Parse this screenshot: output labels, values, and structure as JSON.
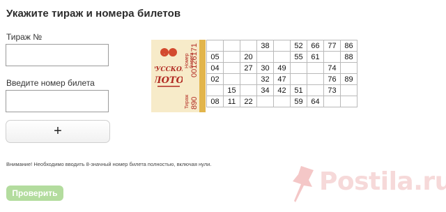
{
  "page": {
    "title": "Укажите тираж и номера билетов"
  },
  "form": {
    "draw_label": "Тираж №",
    "ticket_label": "Введите номер билета",
    "add_button": "+",
    "note": "Внимание! Необходимо вводить 8-значный номер билета полностью, включая нули.",
    "check_button": "Проверить"
  },
  "ticket": {
    "draw_caption": "Тираж",
    "draw_number": "890",
    "number_caption": "Номер билета",
    "ticket_number": "00126171",
    "logo_text": "РУССКОЕ ЛОТО",
    "rows": [
      [
        "",
        "",
        "",
        "38",
        "",
        "52",
        "66",
        "77",
        "86"
      ],
      [
        "05",
        "",
        "20",
        "",
        "",
        "55",
        "61",
        "",
        "88"
      ],
      [
        "04",
        "",
        "27",
        "30",
        "49",
        "",
        "",
        "74",
        ""
      ],
      [
        "02",
        "",
        "",
        "32",
        "47",
        "",
        "",
        "76",
        "89"
      ],
      [
        "",
        "15",
        "",
        "34",
        "42",
        "51",
        "",
        "73",
        ""
      ],
      [
        "08",
        "11",
        "22",
        "",
        "",
        "59",
        "64",
        "",
        ""
      ]
    ]
  },
  "watermark": {
    "text": "Postila.ru",
    "color": "#f4c7c7"
  },
  "colors": {
    "check_button": "#b3dc9e",
    "ticket_stub": "#f7ebc9",
    "ticket_red": "#b12a22"
  }
}
